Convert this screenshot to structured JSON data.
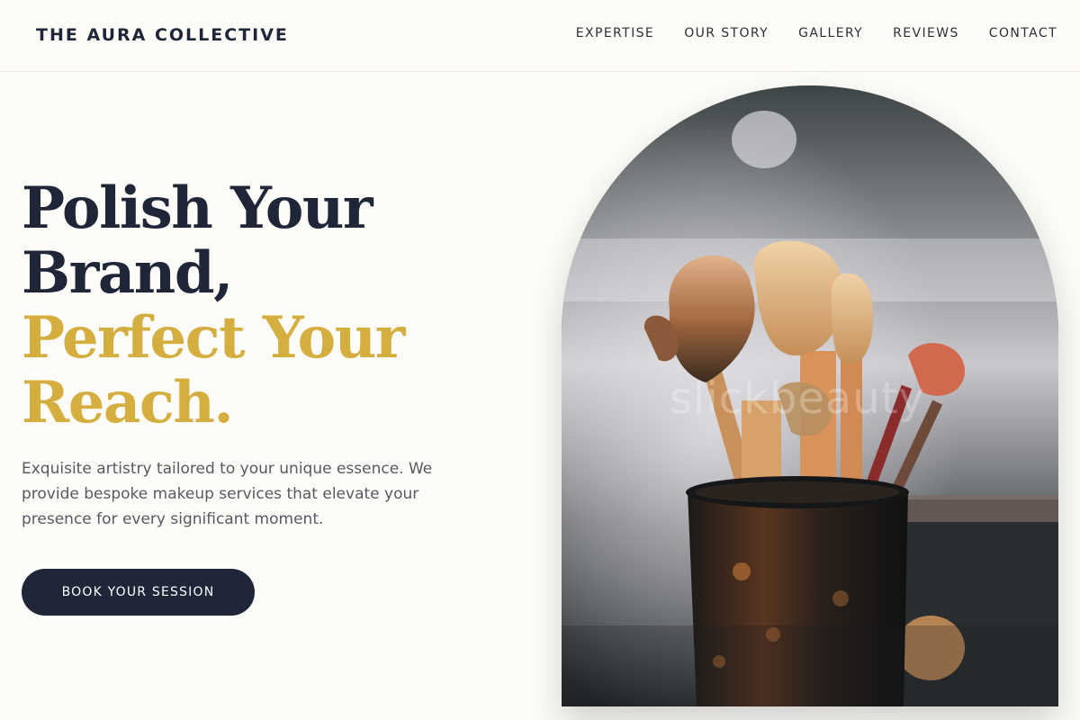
{
  "brand": {
    "name": "THE AURA COLLECTIVE"
  },
  "nav": {
    "items": [
      {
        "label": "EXPERTISE"
      },
      {
        "label": "OUR STORY"
      },
      {
        "label": "GALLERY"
      },
      {
        "label": "REVIEWS"
      },
      {
        "label": "CONTACT"
      }
    ]
  },
  "hero": {
    "headline_lines": [
      "Polish Your",
      "Brand,",
      "Perfect Your",
      "Reach."
    ],
    "description": "Exquisite artistry tailored to your unique essence. We provide bespoke makeup services that elevate your presence for every significant moment.",
    "cta_label": "BOOK YOUR SESSION",
    "image_watermark": "slickbeauty"
  },
  "colors": {
    "primary_dark": "#1e2638",
    "accent_gold": "#d4ae3f",
    "background": "#fdfcf8",
    "body_text": "#555a63"
  },
  "icons": {
    "hero_image": "makeup-brushes-photo"
  }
}
